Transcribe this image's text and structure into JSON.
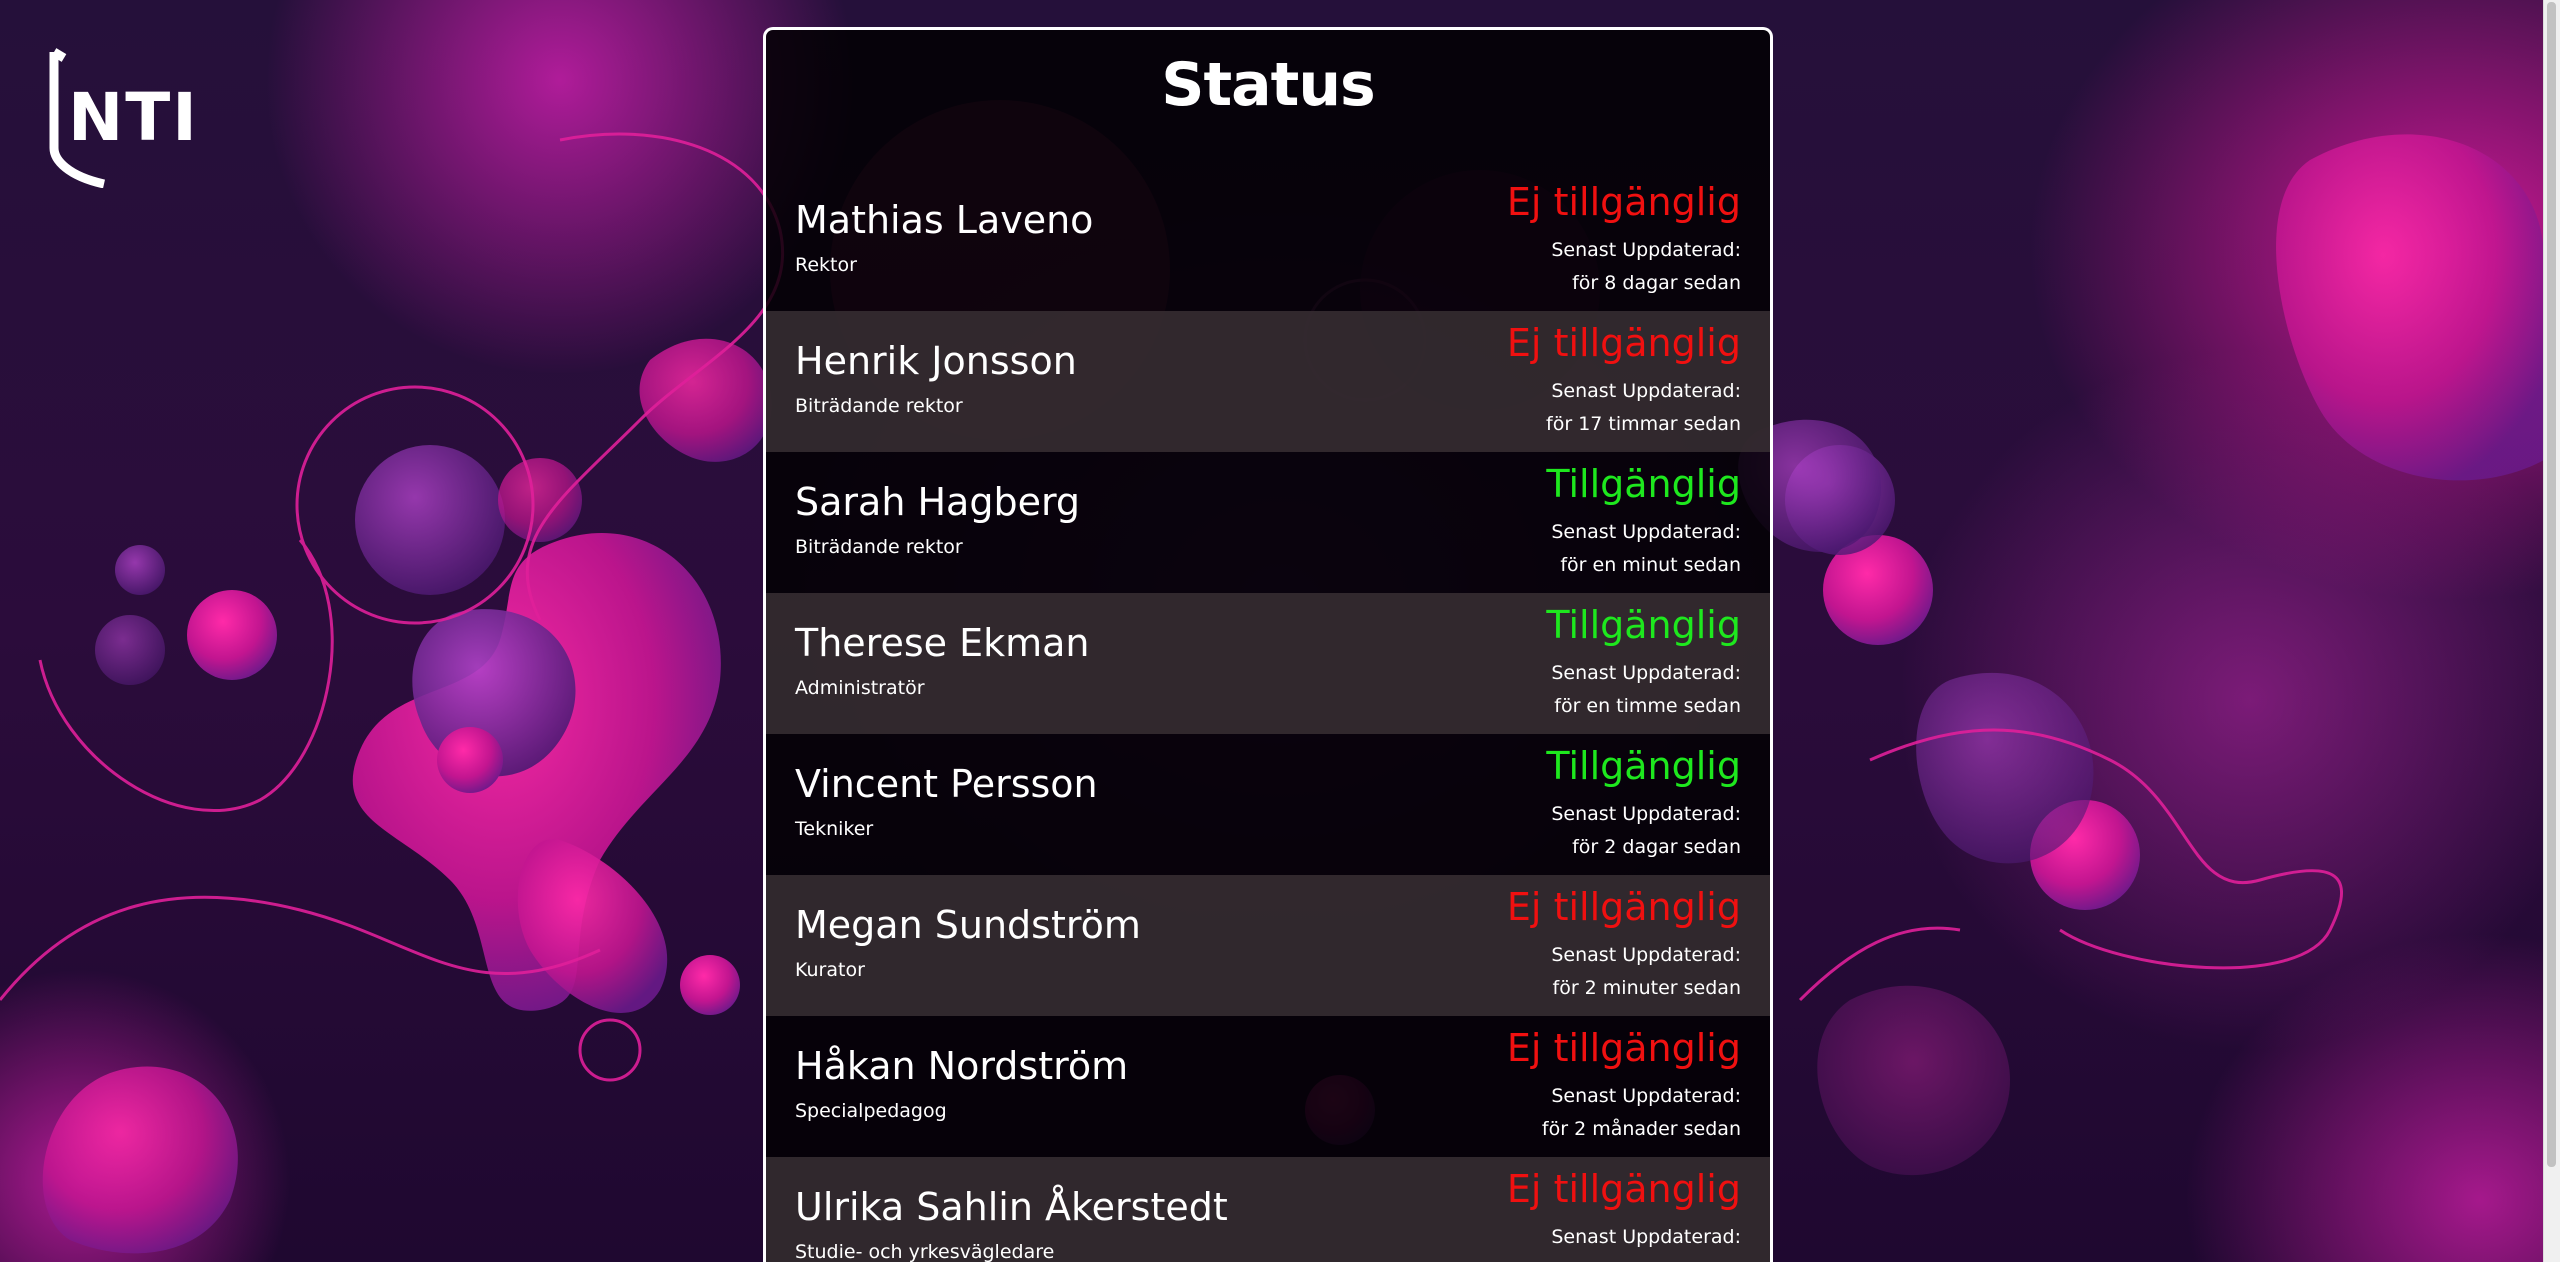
{
  "header": {
    "title": "Status",
    "logo_text": "NTI"
  },
  "colors": {
    "available": "#1ee81e",
    "unavailable": "#f01010",
    "panel_bg": "#000000",
    "row_alt_bg": "#372d32"
  },
  "staff": [
    {
      "name": "Mathias Laveno",
      "role": "Rektor",
      "status": "Ej tillgänglig",
      "available": false,
      "updated_label": "Senast Uppdaterad:",
      "updated_value": "för 8 dagar sedan"
    },
    {
      "name": "Henrik Jonsson",
      "role": "Biträdande rektor",
      "status": "Ej tillgänglig",
      "available": false,
      "updated_label": "Senast Uppdaterad:",
      "updated_value": "för 17 timmar sedan"
    },
    {
      "name": "Sarah Hagberg",
      "role": "Biträdande rektor",
      "status": "Tillgänglig",
      "available": true,
      "updated_label": "Senast Uppdaterad:",
      "updated_value": "för en minut sedan"
    },
    {
      "name": "Therese Ekman",
      "role": "Administratör",
      "status": "Tillgänglig",
      "available": true,
      "updated_label": "Senast Uppdaterad:",
      "updated_value": "för en timme sedan"
    },
    {
      "name": "Vincent Persson",
      "role": "Tekniker",
      "status": "Tillgänglig",
      "available": true,
      "updated_label": "Senast Uppdaterad:",
      "updated_value": "för 2 dagar sedan"
    },
    {
      "name": "Megan Sundström",
      "role": "Kurator",
      "status": "Ej tillgänglig",
      "available": false,
      "updated_label": "Senast Uppdaterad:",
      "updated_value": "för 2 minuter sedan"
    },
    {
      "name": "Håkan Nordström",
      "role": "Specialpedagog",
      "status": "Ej tillgänglig",
      "available": false,
      "updated_label": "Senast Uppdaterad:",
      "updated_value": "för 2 månader sedan"
    },
    {
      "name": "Ulrika Sahlin Åkerstedt",
      "role": "Studie- och yrkesvägledare",
      "status": "Ej tillgänglig",
      "available": false,
      "updated_label": "Senast Uppdaterad:",
      "updated_value": ""
    }
  ]
}
